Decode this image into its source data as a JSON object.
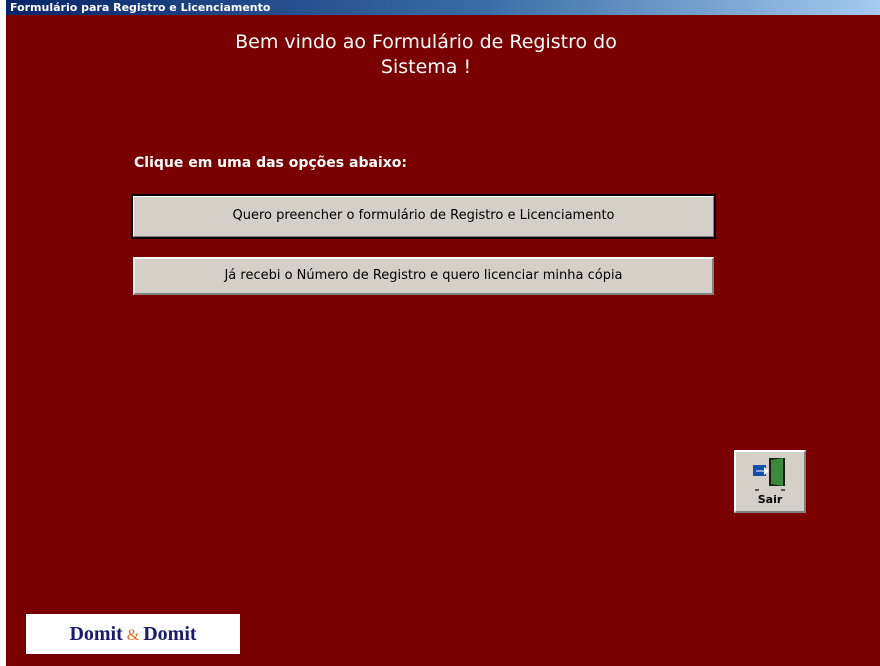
{
  "window": {
    "title": "Formulário para Registro e Licenciamento"
  },
  "main": {
    "welcome": "Bem vindo ao Formulário de Registro do Sistema !",
    "instruction": "Clique em uma das opções abaixo:",
    "option1_label": "Quero preencher o formulário de Registro e Licenciamento",
    "option2_label": "Já recebi o Número de Registro e quero licenciar minha cópia"
  },
  "exit": {
    "label": "Sair",
    "icon": "exit-door-icon"
  },
  "logo": {
    "left": "Domit",
    "amp": "&",
    "right": "Domit"
  },
  "colors": {
    "background": "#7a0000",
    "button_face": "#d4d0c8",
    "titlebar": "#0a246a",
    "logo_text": "#1a1a6e",
    "logo_amp": "#e07020"
  }
}
